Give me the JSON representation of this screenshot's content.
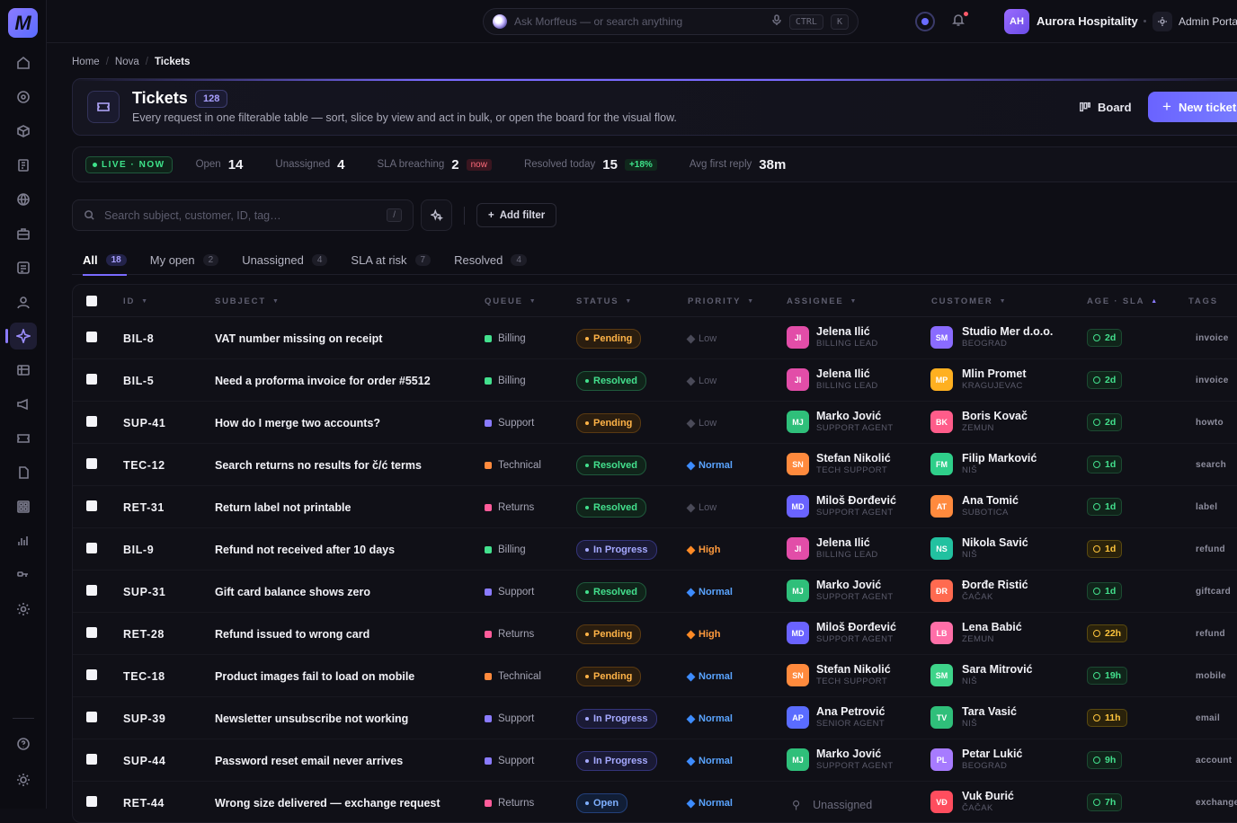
{
  "app": {
    "logo": "M",
    "search_placeholder": "Ask Morffeus — or search anything",
    "kbd_ctrl": "CTRL",
    "kbd_k": "K",
    "org_initials": "AH",
    "org_name": "Aurora Hospitality",
    "admin_label": "Admin Portal"
  },
  "breadcrumb": [
    "Home",
    "Nova",
    "Tickets"
  ],
  "header": {
    "title": "Tickets",
    "count": "128",
    "subtitle": "Every request in one filterable table — sort, slice by view and act in bulk, or open the board for the visual flow.",
    "board_label": "Board",
    "new_label": "New ticket"
  },
  "stats": {
    "live": "LIVE · NOW",
    "open_label": "Open",
    "open_value": "14",
    "unassigned_label": "Unassigned",
    "unassigned_value": "4",
    "sla_label": "SLA breaching",
    "sla_value": "2",
    "sla_tag": "now",
    "resolved_label": "Resolved today",
    "resolved_value": "15",
    "resolved_delta": "+18%",
    "reply_label": "Avg first reply",
    "reply_value": "38m"
  },
  "filter": {
    "placeholder": "Search subject, customer, ID, tag…",
    "shortcut": "/",
    "add_filter": "Add filter"
  },
  "tabs": [
    {
      "label": "All",
      "count": "18"
    },
    {
      "label": "My open",
      "count": "2"
    },
    {
      "label": "Unassigned",
      "count": "4"
    },
    {
      "label": "SLA at risk",
      "count": "7"
    },
    {
      "label": "Resolved",
      "count": "4"
    }
  ],
  "columns": {
    "id": "ID",
    "subject": "SUBJECT",
    "queue": "QUEUE",
    "status": "STATUS",
    "priority": "PRIORITY",
    "assignee": "ASSIGNEE",
    "customer": "CUSTOMER",
    "age": "AGE · SLA",
    "tags": "TAGS"
  },
  "colors": {
    "accent": "#7a6bff",
    "billing": "#43e08d",
    "support": "#8a7bff",
    "technical": "#ff8a3d",
    "returns": "#ff5c9a"
  },
  "tickets": [
    {
      "id": "BIL-8",
      "subject": "VAT number missing on receipt",
      "queue": "Billing",
      "status": "Pending",
      "priority": "Low",
      "assignee": "Jelena Ilić",
      "ainit": "JI",
      "arole": "BILLING LEAD",
      "customer": "Studio Mer d.o.o.",
      "cinit": "SM",
      "city": "BEOGRAD",
      "age": "2d",
      "tag": "invoice"
    },
    {
      "id": "BIL-5",
      "subject": "Need a proforma invoice for order #5512",
      "queue": "Billing",
      "status": "Resolved",
      "priority": "Low",
      "assignee": "Jelena Ilić",
      "ainit": "JI",
      "arole": "BILLING LEAD",
      "customer": "Mlin Promet",
      "cinit": "MP",
      "city": "KRAGUJEVAC",
      "age": "2d",
      "tag": "invoice"
    },
    {
      "id": "SUP-41",
      "subject": "How do I merge two accounts?",
      "queue": "Support",
      "status": "Pending",
      "priority": "Low",
      "assignee": "Marko Jović",
      "ainit": "MJ",
      "arole": "SUPPORT AGENT",
      "customer": "Boris Kovač",
      "cinit": "BK",
      "city": "ZEMUN",
      "age": "2d",
      "tag": "howto"
    },
    {
      "id": "TEC-12",
      "subject": "Search returns no results for č/ć terms",
      "queue": "Technical",
      "status": "Resolved",
      "priority": "Normal",
      "assignee": "Stefan Nikolić",
      "ainit": "SN",
      "arole": "TECH SUPPORT",
      "customer": "Filip Marković",
      "cinit": "FM",
      "city": "NIŠ",
      "age": "1d",
      "tag": "search"
    },
    {
      "id": "RET-31",
      "subject": "Return label not printable",
      "queue": "Returns",
      "status": "Resolved",
      "priority": "Low",
      "assignee": "Miloš Đorđević",
      "ainit": "MD",
      "arole": "SUPPORT AGENT",
      "customer": "Ana Tomić",
      "cinit": "AT",
      "city": "SUBOTICA",
      "age": "1d",
      "tag": "label"
    },
    {
      "id": "BIL-9",
      "subject": "Refund not received after 10 days",
      "queue": "Billing",
      "status": "In Progress",
      "priority": "High",
      "assignee": "Jelena Ilić",
      "ainit": "JI",
      "arole": "BILLING LEAD",
      "customer": "Nikola Savić",
      "cinit": "NS",
      "city": "NIŠ",
      "age": "1d",
      "tag": "refund"
    },
    {
      "id": "SUP-31",
      "subject": "Gift card balance shows zero",
      "queue": "Support",
      "status": "Resolved",
      "priority": "Normal",
      "assignee": "Marko Jović",
      "ainit": "MJ",
      "arole": "SUPPORT AGENT",
      "customer": "Đorđe Ristić",
      "cinit": "ĐR",
      "city": "ČAČAK",
      "age": "1d",
      "tag": "giftcard"
    },
    {
      "id": "RET-28",
      "subject": "Refund issued to wrong card",
      "queue": "Returns",
      "status": "Pending",
      "priority": "High",
      "assignee": "Miloš Đorđević",
      "ainit": "MD",
      "arole": "SUPPORT AGENT",
      "customer": "Lena Babić",
      "cinit": "LB",
      "city": "ZEMUN",
      "age": "22h",
      "tag": "refund"
    },
    {
      "id": "TEC-18",
      "subject": "Product images fail to load on mobile",
      "queue": "Technical",
      "status": "Pending",
      "priority": "Normal",
      "assignee": "Stefan Nikolić",
      "ainit": "SN",
      "arole": "TECH SUPPORT",
      "customer": "Sara Mitrović",
      "cinit": "SM",
      "city": "NIŠ",
      "age": "19h",
      "tag": "mobile"
    },
    {
      "id": "SUP-39",
      "subject": "Newsletter unsubscribe not working",
      "queue": "Support",
      "status": "In Progress",
      "priority": "Normal",
      "assignee": "Ana Petrović",
      "ainit": "AP",
      "arole": "SENIOR AGENT",
      "customer": "Tara Vasić",
      "cinit": "TV",
      "city": "NIŠ",
      "age": "11h",
      "tag": "email"
    },
    {
      "id": "SUP-44",
      "subject": "Password reset email never arrives",
      "queue": "Support",
      "status": "In Progress",
      "priority": "Normal",
      "assignee": "Marko Jović",
      "ainit": "MJ",
      "arole": "SUPPORT AGENT",
      "customer": "Petar Lukić",
      "cinit": "PL",
      "city": "BEOGRAD",
      "age": "9h",
      "tag": "account"
    },
    {
      "id": "RET-44",
      "subject": "Wrong size delivered — exchange request",
      "queue": "Returns",
      "status": "Open",
      "priority": "Normal",
      "assignee": "Unassigned",
      "ainit": "",
      "arole": "",
      "customer": "Vuk Đurić",
      "cinit": "VĐ",
      "city": "ČAČAK",
      "age": "7h",
      "tag": "exchange"
    }
  ]
}
